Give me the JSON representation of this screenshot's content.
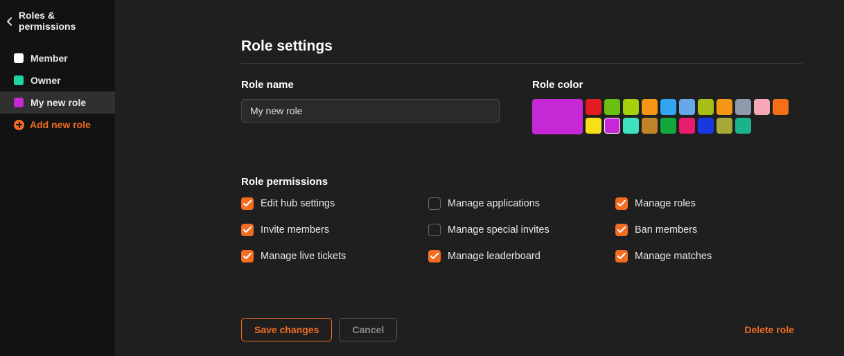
{
  "sidebar": {
    "title": "Roles & permissions",
    "roles": [
      {
        "label": "Member",
        "color": "#ffffff",
        "selected": false
      },
      {
        "label": "Owner",
        "color": "#1fd6a3",
        "selected": false
      },
      {
        "label": "My new role",
        "color": "#c628d6",
        "selected": true
      }
    ],
    "add_label": "Add new role"
  },
  "main": {
    "title": "Role settings",
    "role_name_label": "Role name",
    "role_name_value": "My new role",
    "role_color_label": "Role color",
    "selected_color": "#c628d6",
    "swatches": [
      "#e31b23",
      "#6abf12",
      "#a4d10a",
      "#f59614",
      "#33a6f2",
      "#66a8e8",
      "#a8be17",
      "#f59614",
      "#8c9aab",
      "#f5a7b5",
      "#f56f1a",
      "#f7e018",
      "#c628d6",
      "#3fe1c1",
      "#c08428",
      "#13a83b",
      "#e81d6f",
      "#1739e0",
      "#a8a838",
      "#1bb38c"
    ],
    "active_swatch_index": 12,
    "permissions_label": "Role permissions",
    "permissions": [
      {
        "label": "Edit hub settings",
        "checked": true
      },
      {
        "label": "Manage applications",
        "checked": false
      },
      {
        "label": "Manage roles",
        "checked": true
      },
      {
        "label": "Invite members",
        "checked": true
      },
      {
        "label": "Manage special invites",
        "checked": false
      },
      {
        "label": "Ban members",
        "checked": true
      },
      {
        "label": "Manage live tickets",
        "checked": true
      },
      {
        "label": "Manage leaderboard",
        "checked": true
      },
      {
        "label": "Manage matches",
        "checked": true
      }
    ],
    "save_label": "Save changes",
    "cancel_label": "Cancel",
    "delete_label": "Delete role"
  }
}
